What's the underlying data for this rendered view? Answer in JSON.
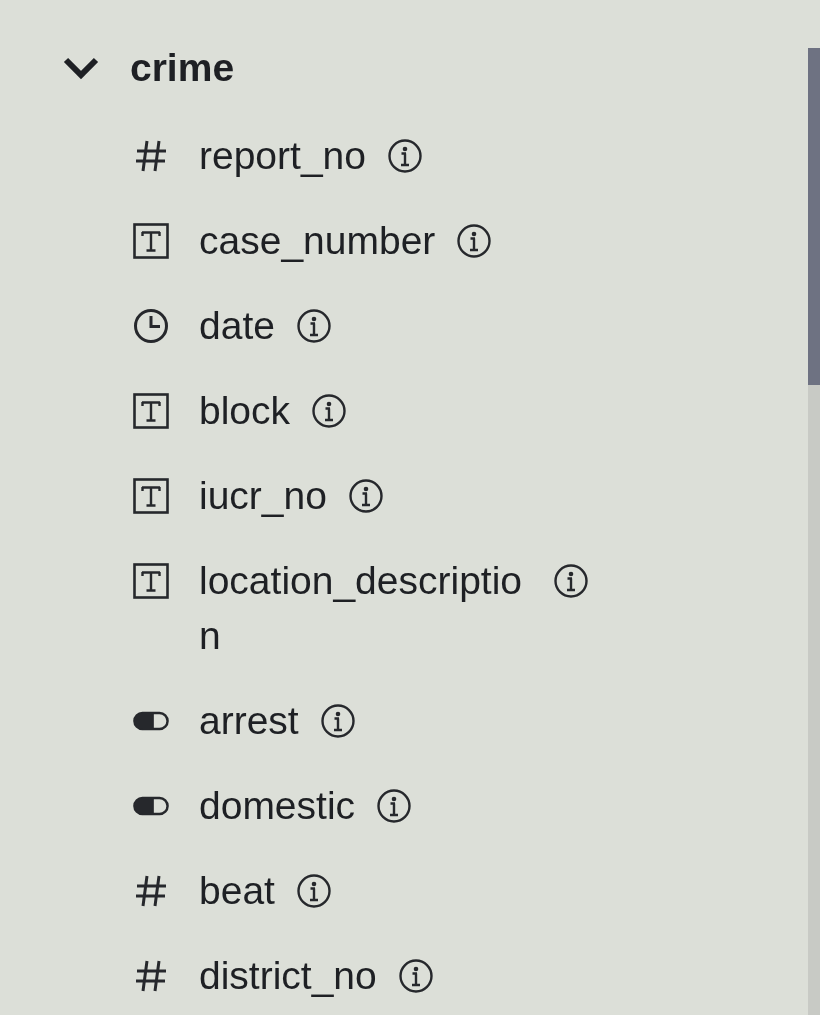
{
  "schema_tree": {
    "label": "crime",
    "expanded": true,
    "children": [
      {
        "label": "report_no",
        "kind": "number"
      },
      {
        "label": "case_number",
        "kind": "text"
      },
      {
        "label": "date",
        "kind": "datetime"
      },
      {
        "label": "block",
        "kind": "text"
      },
      {
        "label": "iucr_no",
        "kind": "text"
      },
      {
        "label": "location_description",
        "kind": "text"
      },
      {
        "label": "arrest",
        "kind": "boolean"
      },
      {
        "label": "domestic",
        "kind": "boolean"
      },
      {
        "label": "beat",
        "kind": "number"
      },
      {
        "label": "district_no",
        "kind": "number"
      }
    ]
  }
}
